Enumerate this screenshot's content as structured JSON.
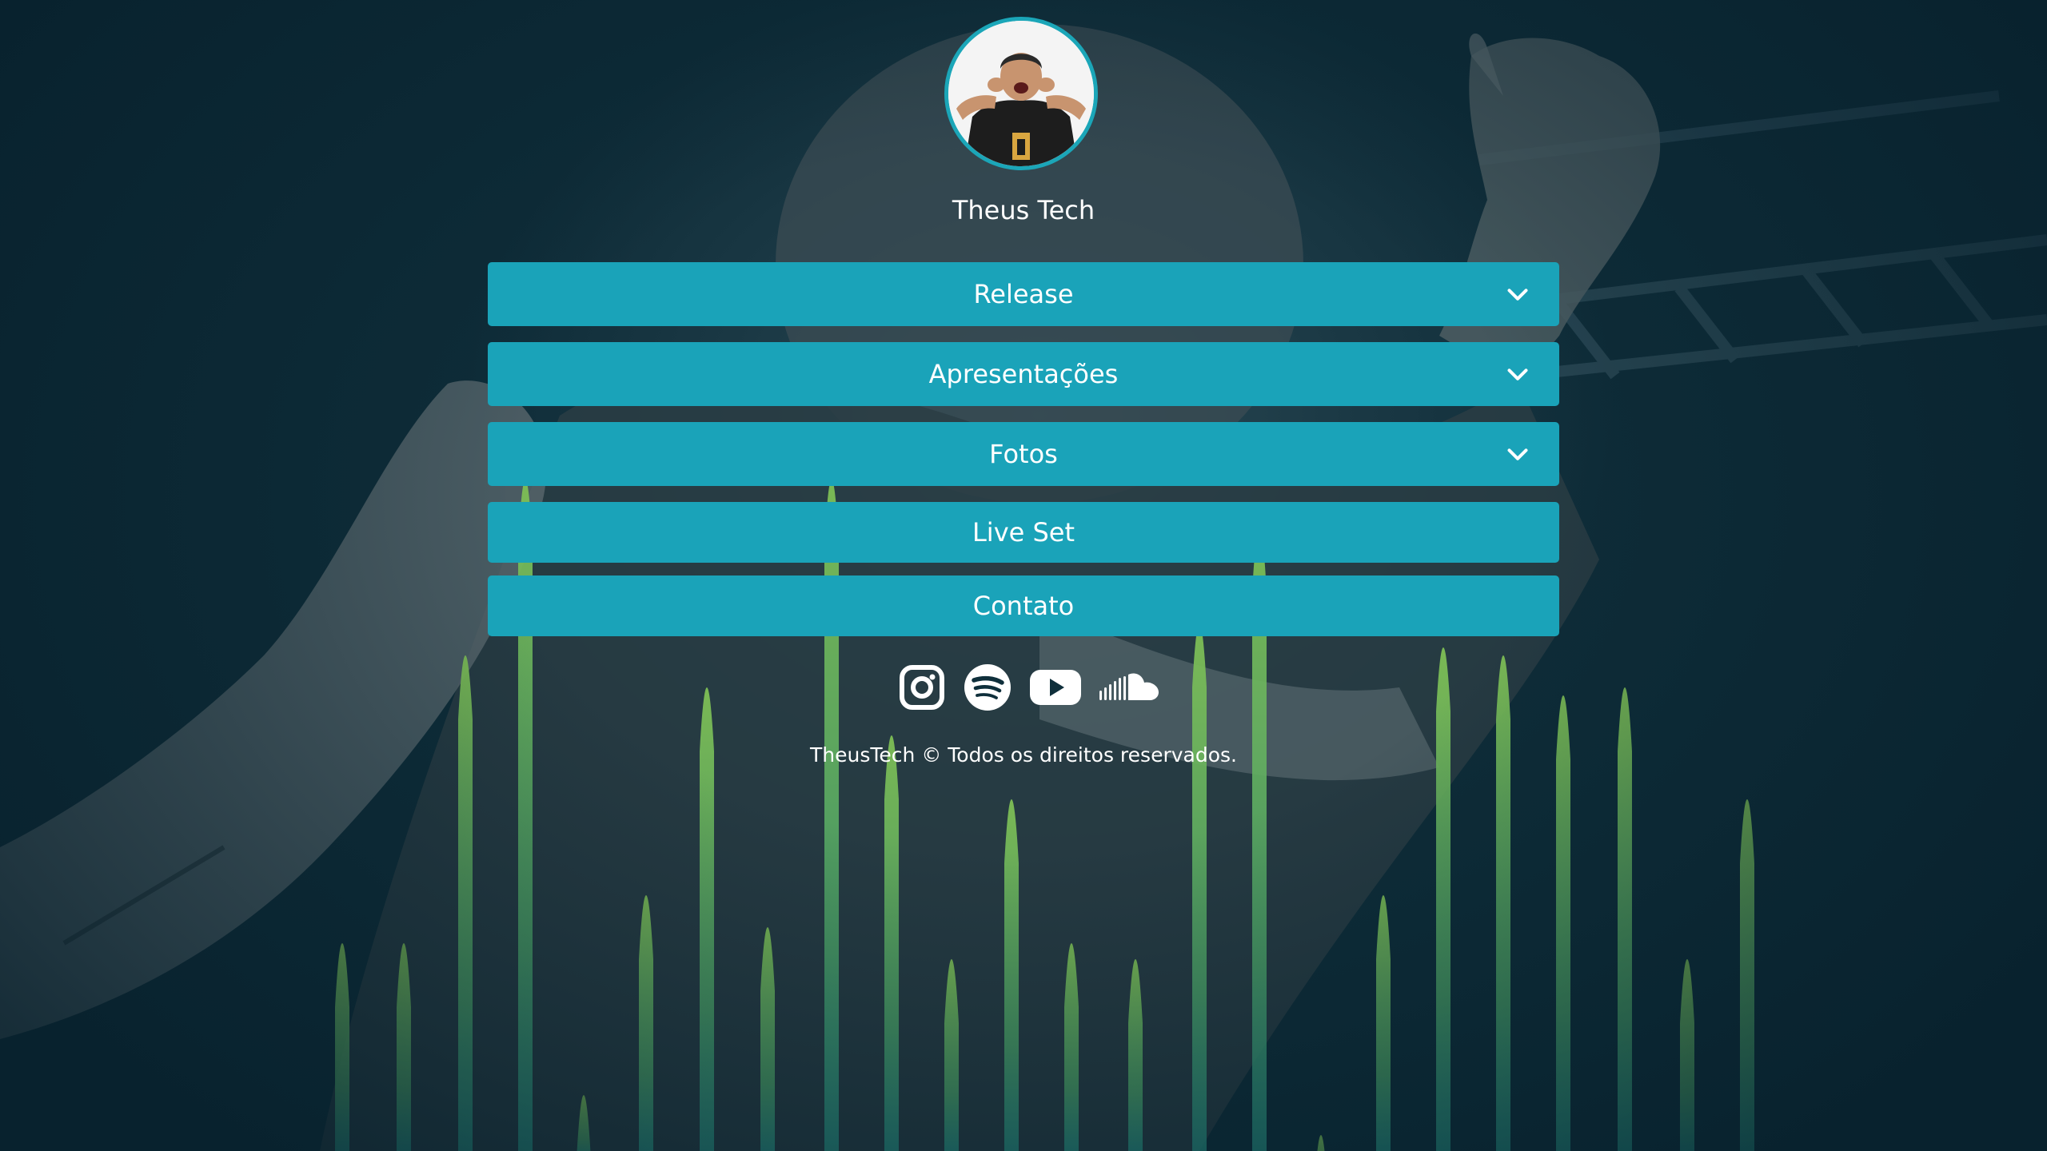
{
  "profile": {
    "name": "Theus Tech",
    "accent_color": "#1aa3b9"
  },
  "menu": {
    "items": [
      {
        "label": "Release",
        "expandable": true
      },
      {
        "label": "Apresentações",
        "expandable": true
      },
      {
        "label": "Fotos",
        "expandable": true
      },
      {
        "label": "Live Set",
        "expandable": false
      },
      {
        "label": "Contato",
        "expandable": false
      }
    ]
  },
  "socials": [
    {
      "icon": "instagram-icon"
    },
    {
      "icon": "spotify-icon"
    },
    {
      "icon": "youtube-icon"
    },
    {
      "icon": "soundcloud-icon"
    }
  ],
  "footer": {
    "text": "TheusTech © Todos os direitos reservados."
  },
  "background": {
    "base_color": "#0d2a36",
    "equalizer_color": "#6fae4c"
  }
}
